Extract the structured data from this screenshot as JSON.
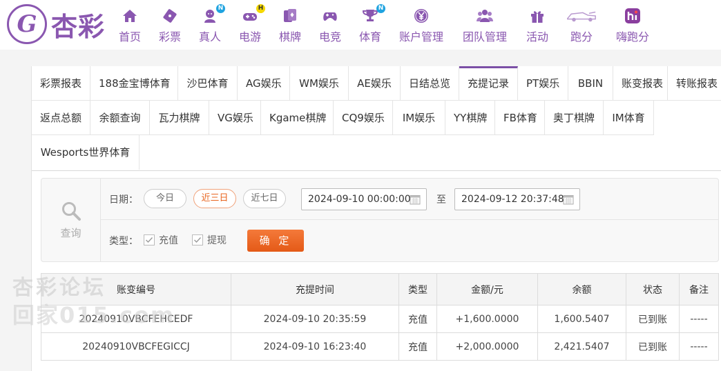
{
  "brand": {
    "logo_text": "杏彩",
    "logo_letter": "G"
  },
  "nav": [
    {
      "label": "首页",
      "icon": "home-icon",
      "badge": ""
    },
    {
      "label": "彩票",
      "icon": "lottery-ticket-icon",
      "badge": ""
    },
    {
      "label": "真人",
      "icon": "live-dealer-icon",
      "badge": "N"
    },
    {
      "label": "电游",
      "icon": "gamepad-icon",
      "badge": "H"
    },
    {
      "label": "棋牌",
      "icon": "cards-icon",
      "badge": ""
    },
    {
      "label": "电竞",
      "icon": "esports-controller-icon",
      "badge": ""
    },
    {
      "label": "体育",
      "icon": "trophy-icon",
      "badge": "N"
    },
    {
      "label": "账户管理",
      "icon": "yen-coin-icon",
      "badge": ""
    },
    {
      "label": "团队管理",
      "icon": "team-icon",
      "badge": ""
    },
    {
      "label": "活动",
      "icon": "gift-icon",
      "badge": ""
    },
    {
      "label": "跑分",
      "icon": "race-car-icon",
      "badge": ""
    },
    {
      "label": "嗨跑分",
      "icon": "hi-app-icon",
      "badge": ""
    }
  ],
  "tabs": [
    "彩票报表",
    "188金宝博体育",
    "沙巴体育",
    "AG娱乐",
    "WM娱乐",
    "AE娱乐",
    "日结总览",
    "充提记录",
    "PT娱乐",
    "BBIN",
    "账变报表",
    "转账报表",
    "返点总额",
    "余额查询",
    "瓦力棋牌",
    "VG娱乐",
    "Kgame棋牌",
    "CQ9娱乐",
    "IM娱乐",
    "YY棋牌",
    "FB体育",
    "奥丁棋牌",
    "IM体育",
    "Wesports世界体育"
  ],
  "active_tab": "充提记录",
  "query": {
    "side_label": "查询",
    "date_label": "日期：",
    "quick_ranges": [
      "今日",
      "近三日",
      "近七日"
    ],
    "active_range": "近三日",
    "start_date": "2024-09-10 00:00:00",
    "to_label": "至",
    "end_date": "2024-09-12 20:37:48",
    "type_label": "类型：",
    "types": [
      {
        "label": "充值",
        "checked": true
      },
      {
        "label": "提现",
        "checked": true
      }
    ],
    "confirm_label": "确 定"
  },
  "table": {
    "headers": [
      "账变编号",
      "充提时间",
      "类型",
      "金额/元",
      "余额",
      "状态",
      "备注"
    ],
    "rows": [
      [
        "20240910VBCFEHCEDF",
        "2024-09-10 20:35:59",
        "充值",
        "+1,600.0000",
        "1,600.5407",
        "已到账",
        "-----"
      ],
      [
        "20240910VBCFEGICCJ",
        "2024-09-10 16:23:40",
        "充值",
        "+2,000.0000",
        "2,421.5407",
        "已到账",
        "-----"
      ]
    ]
  },
  "watermark": {
    "line1": "杏彩论坛",
    "line2": "回家015.com"
  },
  "colors": {
    "brand": "#8a57b0",
    "accent": "#e8641e",
    "amount": "#e2231a",
    "success": "#2a9d2a"
  }
}
